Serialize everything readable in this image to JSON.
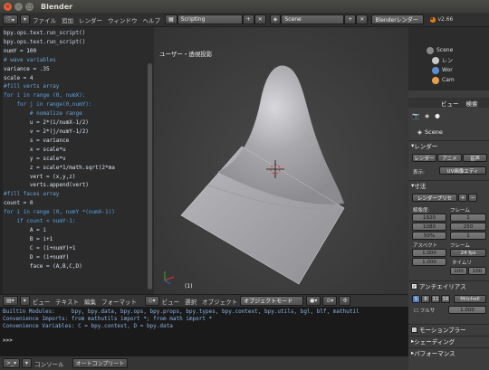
{
  "window": {
    "title": "Blender"
  },
  "info_header": {
    "menus": [
      "ファイル",
      "追加",
      "レンダー",
      "ウィンドウ",
      "ヘルプ"
    ],
    "layout": "Scripting",
    "scene": "Scene",
    "engine": "Blenderレンダー",
    "version": "v2.66"
  },
  "text_editor": {
    "lines": [
      {
        "t": "bpy.ops.text.run_script()",
        "c": "c-ws"
      },
      {
        "t": "bpy.ops.text.run_script()",
        "c": "c-ws"
      },
      {
        "t": "numY = 100",
        "c": "c-tx"
      },
      {
        "t": "",
        "c": "c-tx"
      },
      {
        "t": "# wave variables",
        "c": "c-cm"
      },
      {
        "t": "variance = .35",
        "c": "c-tx"
      },
      {
        "t": "scale = 4",
        "c": "c-tx"
      },
      {
        "t": "",
        "c": "c-tx"
      },
      {
        "t": "#fill verts array",
        "c": "c-cm"
      },
      {
        "t": "for i in range (0, numX):",
        "c": "c-kw"
      },
      {
        "t": "    for j in range(0,numY):",
        "c": "c-kw"
      },
      {
        "t": "        # nomalize range",
        "c": "c-cm"
      },
      {
        "t": "        u = 2*(i/numX-1/2)",
        "c": "c-tx"
      },
      {
        "t": "        v = 2*(j/numY-1/2)",
        "c": "c-tx"
      },
      {
        "t": "",
        "c": "c-tx"
      },
      {
        "t": "        s = variance",
        "c": "c-tx"
      },
      {
        "t": "        x = scale*u",
        "c": "c-tx"
      },
      {
        "t": "        y = scale*v",
        "c": "c-tx"
      },
      {
        "t": "        z = scale*1/math.sqrt(2*ma",
        "c": "c-tx"
      },
      {
        "t": "",
        "c": "c-tx"
      },
      {
        "t": "        vert = (x,y,z)",
        "c": "c-tx"
      },
      {
        "t": "        verts.append(vert)",
        "c": "c-tx"
      },
      {
        "t": "",
        "c": "c-tx"
      },
      {
        "t": "#fill faces array",
        "c": "c-cm"
      },
      {
        "t": "count = 0",
        "c": "c-tx"
      },
      {
        "t": "for i in range (0, numY *(numX-1))",
        "c": "c-kw"
      },
      {
        "t": "    if count < numY-1:",
        "c": "c-kw"
      },
      {
        "t": "        A = i",
        "c": "c-tx"
      },
      {
        "t": "        B = i+1",
        "c": "c-tx"
      },
      {
        "t": "        C = (i+numY)+1",
        "c": "c-tx"
      },
      {
        "t": "        D = (i+numY)",
        "c": "c-tx"
      },
      {
        "t": "        face = (A,B,C,D)",
        "c": "c-tx"
      }
    ]
  },
  "viewport": {
    "label": "ユーザー・透視投影",
    "object_label": "(1)"
  },
  "text_header": {
    "menus": [
      "ビュー",
      "テキスト",
      "編集",
      "フォーマット"
    ],
    "viewport_menus": [
      "ビュー",
      "選択",
      "オブジェクト"
    ],
    "mode": "オブジェクトモード"
  },
  "console": {
    "lines": [
      "Builtin Modules:     bpy, bpy.data, bpy.ops, bpy.props, bpy.types, bpy.context, bpy.utils, bgl, blf, mathutil",
      "Convenience Imports: from mathutils import *; from math import *",
      "Convenience Variables: C = bpy.context, D = bpy.data"
    ],
    "prompt": ">>> ",
    "header_menu": "コンソール",
    "autocomplete": "オートコンプリート"
  },
  "outliner": {
    "items": [
      "Scene",
      "レン",
      "Wor",
      "Cam"
    ]
  },
  "properties": {
    "header_tabs": [
      "ビュー",
      "検索"
    ],
    "scene": "Scene",
    "render_section": "レンダー",
    "render_btn": "レンダー",
    "anim_btn": "アニメ",
    "audio_btn": "音声",
    "display_label": "表示:",
    "display_value": "UV画像エディ",
    "dimensions_section": "寸法",
    "preset": "レンダープリセ",
    "res_label": "解像度:",
    "frame_label": "フレーム",
    "res_x": "1920",
    "res_y": "1080",
    "res_pct": "50%",
    "frame_start": "1",
    "frame_end": "250",
    "frame_step": "1",
    "aspect_label": "アスペクト",
    "framerate_label": "フレーム",
    "aspect_x": "1.000",
    "aspect_y": "1.000",
    "fps": "24 fps",
    "time_label": "タイムリ",
    "time_1": "100",
    "time_2": "100",
    "aa_section": "アンチエイリアス",
    "aa_samples": [
      "5",
      "8",
      "11",
      "16"
    ],
    "aa_filter": "Mitchell",
    "full_sample": "フルサ",
    "filter_size": "1.000",
    "motion_blur_section": "モーションブラー",
    "shading_section": "シェーディング",
    "performance_section": "パフォーマンス"
  }
}
